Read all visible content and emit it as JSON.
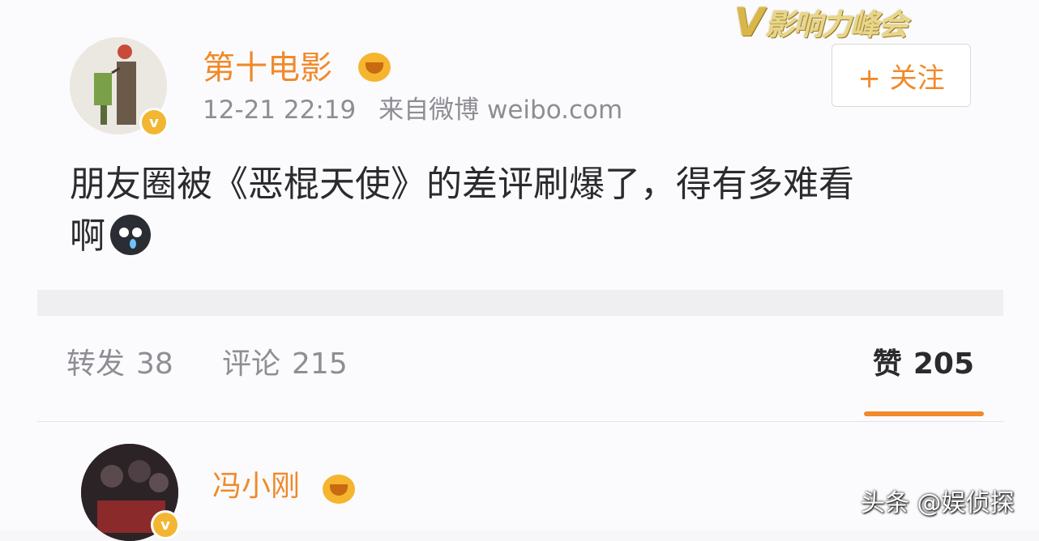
{
  "overlay_logo": {
    "prefix": "V",
    "text": "影响力峰会"
  },
  "post": {
    "username": "第十电影",
    "timestamp": "12-21 22:19",
    "source": "来自微博 weibo.com",
    "follow_label": "+ 关注",
    "text_line1": "朋友圈被《恶棍天使》的差评刷爆了，得有多难看",
    "text_line2": "啊",
    "emoji": "cry-emoji"
  },
  "actions": {
    "repost_label": "转发",
    "repost_count": "38",
    "comment_label": "评论",
    "comment_count": "215",
    "like_label": "赞",
    "like_count": "205"
  },
  "comment": {
    "username": "冯小刚"
  },
  "watermark": "头条 @娱侦探",
  "colors": {
    "accent": "#f08a2a",
    "verified": "#f2b632",
    "text": "#2b2b2d",
    "muted": "#8e8e94"
  }
}
